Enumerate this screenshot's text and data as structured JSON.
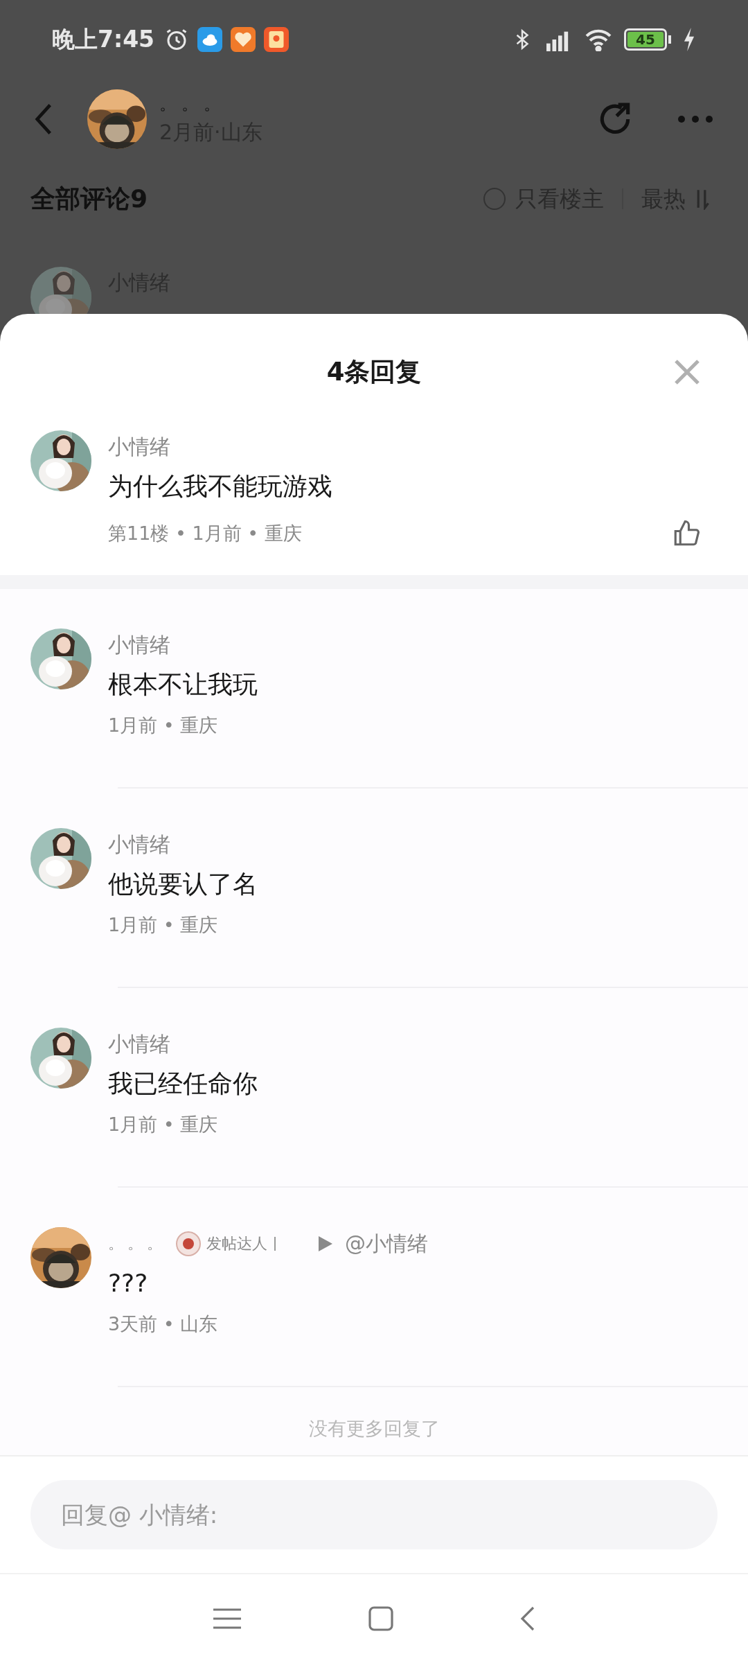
{
  "status_bar": {
    "time": "晚上7:45",
    "battery": "45"
  },
  "post_header": {
    "author": "。。。",
    "meta": "2月前·山东"
  },
  "comments_bar": {
    "title": "全部评论9",
    "owner_only": {
      "label": "只看楼主",
      "checked": false
    },
    "sort": "最热"
  },
  "behind_comment": {
    "name": "小情绪"
  },
  "sheet": {
    "title": "4条回复",
    "main_comment": {
      "name": "小情绪",
      "text": "为什么我不能玩游戏",
      "meta": "第11楼 • 1月前 • 重庆"
    },
    "replies": [
      {
        "kind": "plain",
        "name": "小情绪",
        "text": "根本不让我玩",
        "meta": "1月前 • 重庆"
      },
      {
        "kind": "plain",
        "name": "小情绪",
        "text": "他说要认了名",
        "meta": "1月前 • 重庆"
      },
      {
        "kind": "plain",
        "name": "小情绪",
        "text": "我已经任命你",
        "meta": "1月前 • 重庆"
      },
      {
        "kind": "reply_to",
        "name": "。。。",
        "badge": "发帖达人",
        "target": "@小情绪",
        "text": "???",
        "meta": "3天前 • 山东"
      }
    ],
    "end_note": "没有更多回复了"
  },
  "reply_input": {
    "placeholder": "回复@ 小情绪:"
  }
}
